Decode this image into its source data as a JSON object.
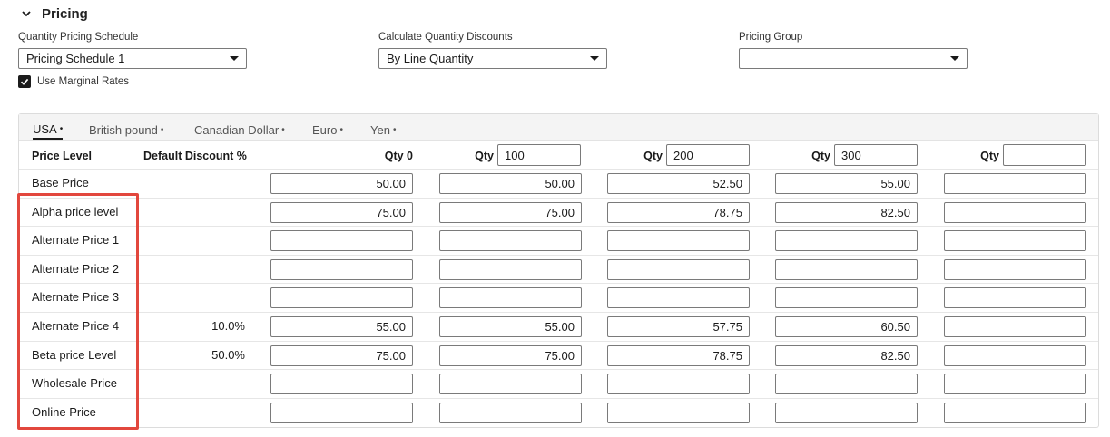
{
  "section": {
    "title": "Pricing"
  },
  "fields": {
    "quantity_pricing_schedule": {
      "label": "Quantity Pricing Schedule",
      "value": "Pricing Schedule 1"
    },
    "calculate_quantity_discounts": {
      "label": "Calculate Quantity Discounts",
      "value": "By Line Quantity"
    },
    "pricing_group": {
      "label": "Pricing Group",
      "value": ""
    }
  },
  "use_marginal_rates": {
    "label": "Use Marginal Rates",
    "checked": true
  },
  "tabs": [
    {
      "label": "USA",
      "active": true
    },
    {
      "label": "British pound",
      "active": false
    },
    {
      "label": "Canadian Dollar",
      "active": false
    },
    {
      "label": "Euro",
      "active": false
    },
    {
      "label": "Yen",
      "active": false
    }
  ],
  "tab_marker": "•",
  "table": {
    "price_level_header": "Price Level",
    "discount_header": "Default Discount %",
    "qty_label": "Qty",
    "qty_columns": [
      {
        "label": "Qty 0",
        "value": null
      },
      {
        "label": "Qty",
        "value": "100"
      },
      {
        "label": "Qty",
        "value": "200"
      },
      {
        "label": "Qty",
        "value": "300"
      },
      {
        "label": "Qty",
        "value": ""
      }
    ],
    "rows": [
      {
        "label": "Base Price",
        "discount": "",
        "values": [
          "50.00",
          "50.00",
          "52.50",
          "55.00",
          ""
        ]
      },
      {
        "label": "Alpha price level",
        "discount": "",
        "values": [
          "75.00",
          "75.00",
          "78.75",
          "82.50",
          ""
        ]
      },
      {
        "label": "Alternate Price 1",
        "discount": "",
        "values": [
          "",
          "",
          "",
          "",
          ""
        ]
      },
      {
        "label": "Alternate Price 2",
        "discount": "",
        "values": [
          "",
          "",
          "",
          "",
          ""
        ]
      },
      {
        "label": "Alternate Price 3",
        "discount": "",
        "values": [
          "",
          "",
          "",
          "",
          ""
        ]
      },
      {
        "label": "Alternate Price 4",
        "discount": "10.0%",
        "values": [
          "55.00",
          "55.00",
          "57.75",
          "60.50",
          ""
        ]
      },
      {
        "label": "Beta price Level",
        "discount": "50.0%",
        "values": [
          "75.00",
          "75.00",
          "78.75",
          "82.50",
          ""
        ]
      },
      {
        "label": "Wholesale Price",
        "discount": "",
        "values": [
          "",
          "",
          "",
          "",
          ""
        ]
      },
      {
        "label": "Online Price",
        "discount": "",
        "values": [
          "",
          "",
          "",
          "",
          ""
        ]
      }
    ]
  },
  "colors": {
    "highlight": "#e2473d"
  }
}
